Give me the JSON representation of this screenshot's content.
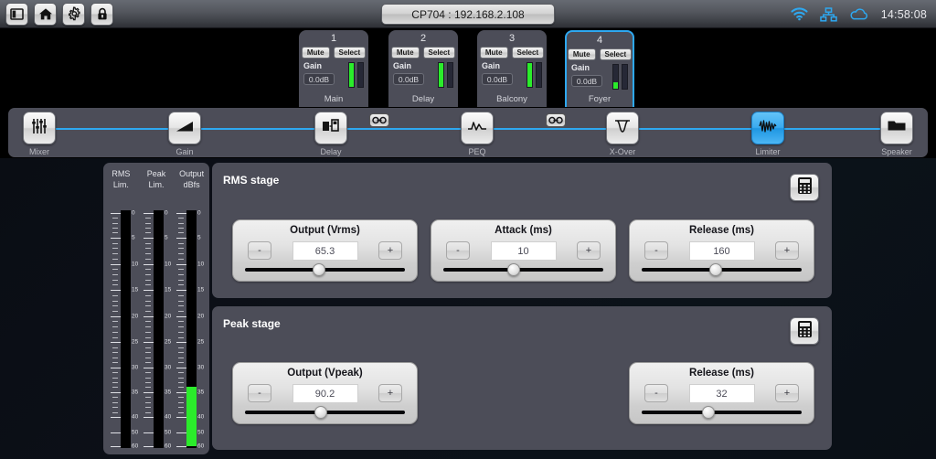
{
  "topbar": {
    "buttons": [
      {
        "name": "panel-toggle",
        "icon": "panel-icon"
      },
      {
        "name": "home",
        "icon": "home-icon"
      },
      {
        "name": "settings",
        "icon": "gear-icon"
      },
      {
        "name": "lock",
        "icon": "lock-icon"
      }
    ],
    "title": "CP704 : 192.168.2.108",
    "status_icons": [
      "wifi-icon",
      "network-icon",
      "cloud-icon"
    ],
    "clock": "14:58:08"
  },
  "channels": [
    {
      "num": "1",
      "mute": "Mute",
      "select": "Select",
      "gain_label": "Gain",
      "gain_value": "0.0dB",
      "name": "Main",
      "meter_a": 100,
      "meter_b": 0
    },
    {
      "num": "2",
      "mute": "Mute",
      "select": "Select",
      "gain_label": "Gain",
      "gain_value": "0.0dB",
      "name": "Delay",
      "meter_a": 100,
      "meter_b": 0
    },
    {
      "num": "3",
      "mute": "Mute",
      "select": "Select",
      "gain_label": "Gain",
      "gain_value": "0.0dB",
      "name": "Balcony",
      "meter_a": 100,
      "meter_b": 0
    },
    {
      "num": "4",
      "mute": "Mute",
      "select": "Select",
      "gain_label": "Gain",
      "gain_value": "0.0dB",
      "name": "Foyer",
      "meter_a": 26,
      "meter_b": 0,
      "selected": true
    }
  ],
  "links": [
    "link-icon",
    "link-icon"
  ],
  "nav": {
    "items": [
      {
        "label": "Mixer",
        "icon": "faders-icon",
        "active": false
      },
      {
        "label": "Gain",
        "icon": "gain-ramp-icon",
        "active": false
      },
      {
        "label": "Delay",
        "icon": "delay-icon",
        "active": false
      },
      {
        "label": "PEQ",
        "icon": "peq-curve-icon",
        "active": false
      },
      {
        "label": "X-Over",
        "icon": "xover-icon",
        "active": false
      },
      {
        "label": "Limiter",
        "icon": "limiter-wave-icon",
        "active": true
      },
      {
        "label": "Speaker",
        "icon": "speaker-folder-icon",
        "active": false
      }
    ]
  },
  "meter_panel": {
    "columns": [
      {
        "line1": "RMS",
        "line2": "Lim.",
        "fill_percent": 0
      },
      {
        "line1": "Peak",
        "line2": "Lim.",
        "fill_percent": 0
      },
      {
        "line1": "Output",
        "line2": "dBfs",
        "fill_percent": 25
      }
    ],
    "scale_labels": [
      "0",
      "5",
      "10",
      "15",
      "20",
      "25",
      "30",
      "35",
      "40",
      "50",
      "60"
    ]
  },
  "stages": [
    {
      "title": "RMS stage",
      "calc_icon": "calculator-icon",
      "controls": [
        {
          "label": "Output (Vrms)",
          "value": "65.3",
          "minus": "-",
          "plus": "+",
          "thumb_percent": 45
        },
        {
          "label": "Attack (ms)",
          "value": "10",
          "minus": "-",
          "plus": "+",
          "thumb_percent": 43
        },
        {
          "label": "Release (ms)",
          "value": "160",
          "minus": "-",
          "plus": "+",
          "thumb_percent": 45
        }
      ]
    },
    {
      "title": "Peak stage",
      "calc_icon": "calculator-icon",
      "controls": [
        {
          "label": "Output (Vpeak)",
          "value": "90.2",
          "minus": "-",
          "plus": "+",
          "thumb_percent": 46
        },
        {
          "label": "Release (ms)",
          "value": "32",
          "minus": "-",
          "plus": "+",
          "thumb_percent": 41
        }
      ]
    }
  ],
  "colors": {
    "accent": "#2ea8f0",
    "panel": "#4c4d58",
    "meter_green": "#2bec2b"
  }
}
